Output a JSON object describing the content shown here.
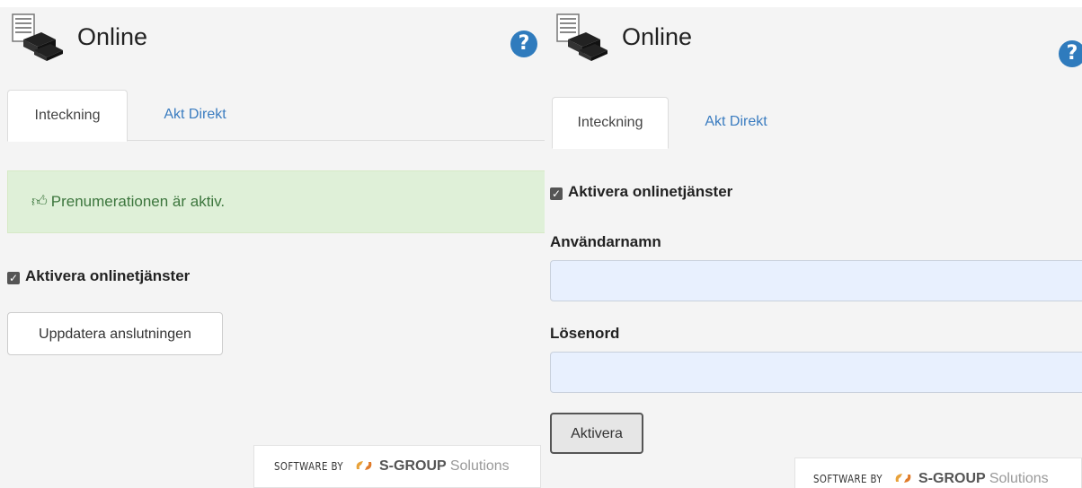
{
  "left": {
    "title": "Online",
    "tabs": [
      {
        "label": "Inteckning",
        "active": true
      },
      {
        "label": "Akt Direkt",
        "active": false
      }
    ],
    "alert": "Prenumerationen är aktiv.",
    "checkbox_label": "Aktivera onlinetjänster",
    "update_button": "Uppdatera anslutningen",
    "footer": {
      "prefix": "SOFTWARE BY",
      "brand": "S-GROUP",
      "suffix": "Solutions"
    }
  },
  "right": {
    "title": "Online",
    "tabs": [
      {
        "label": "Inteckning",
        "active": true
      },
      {
        "label": "Akt Direkt",
        "active": false
      }
    ],
    "checkbox_label": "Aktivera onlinetjänster",
    "username_label": "Användarnamn",
    "username_value": "",
    "password_label": "Lösenord",
    "password_value": "",
    "activate_button": "Aktivera",
    "footer": {
      "prefix": "SOFTWARE BY",
      "brand": "S-GROUP",
      "suffix": "Solutions"
    }
  },
  "icons": {
    "app": "server-books-icon",
    "help": "help-question-icon",
    "alert": "thumbs-up-icon",
    "checkbox": "checkbox-checked-icon",
    "footer_logo": "s-group-logo-icon"
  },
  "colors": {
    "help": "#2f7bbd",
    "link": "#3a7cc0",
    "alert_bg": "#dff0d8",
    "alert_text": "#3c763d",
    "input_bg": "#e8f0fe"
  }
}
